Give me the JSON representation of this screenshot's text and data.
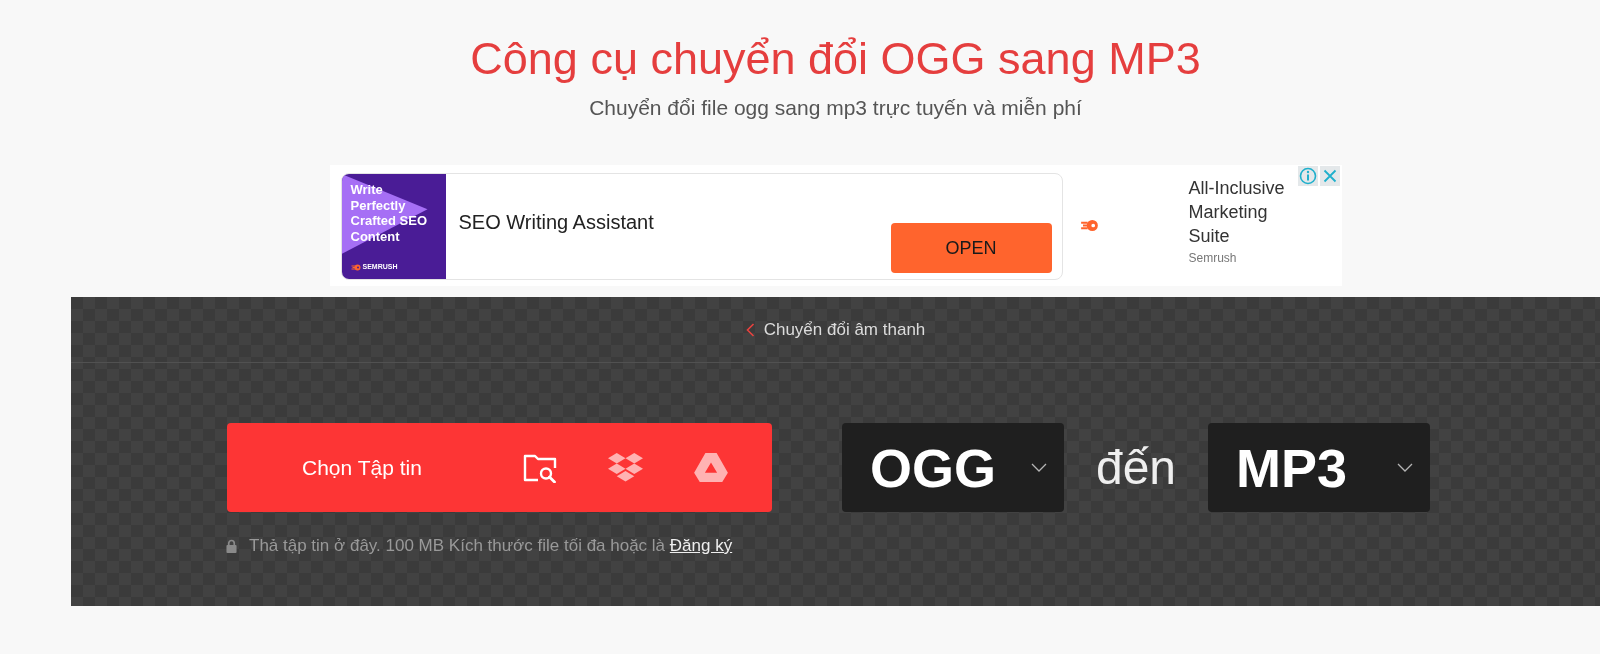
{
  "header": {
    "title": "Công cụ chuyển đổi OGG sang MP3",
    "subtitle": "Chuyển đổi file ogg sang mp3 trực tuyến và miễn phí"
  },
  "ad": {
    "image_text": "Write Perfectly Crafted SEO Content",
    "image_brand": "SEMRUSH",
    "headline": "SEO Writing Assistant",
    "button": "OPEN",
    "tagline": "All-Inclusive Marketing Suite",
    "advertiser": "Semrush"
  },
  "converter": {
    "breadcrumb": "Chuyển đổi âm thanh",
    "choose_button": "Chọn Tập tin",
    "from_format": "OGG",
    "connector": "đến",
    "to_format": "MP3",
    "hint": "Thả tập tin ở đây. 100 MB Kích thước file tối đa hoặc là",
    "signup_link": "Đăng ký"
  }
}
